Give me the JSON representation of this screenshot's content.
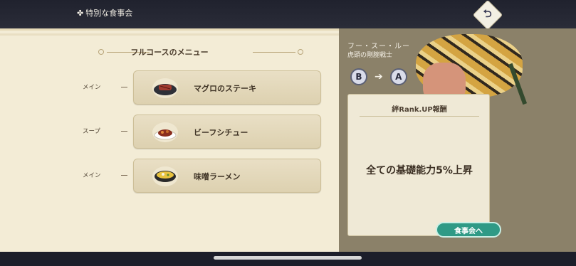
{
  "window": {
    "title": "特別な食事会",
    "title_icon": "emblem-icon",
    "back_icon": "return-icon"
  },
  "menu": {
    "header": "フルコースのメニュー",
    "items": [
      {
        "course": "メイン",
        "name": "マグロのステーキ",
        "icon": "tuna-steak-icon"
      },
      {
        "course": "スープ",
        "name": "ビーフシチュー",
        "icon": "beef-stew-icon"
      },
      {
        "course": "メイン",
        "name": "味噌ラーメン",
        "icon": "miso-ramen-icon"
      }
    ]
  },
  "character": {
    "name": "フー・スー・ルー",
    "title": "虎頭の剛腕戦士",
    "rank_from": "B",
    "rank_to": "A"
  },
  "reward": {
    "header": "絆Rank.UP報酬",
    "text": "全ての基礎能力5%上昇"
  },
  "actions": {
    "dine_label": "食事会へ"
  },
  "colors": {
    "accent": "#2f9a86",
    "panel": "#f3ecd6",
    "side": "#8b8169"
  }
}
